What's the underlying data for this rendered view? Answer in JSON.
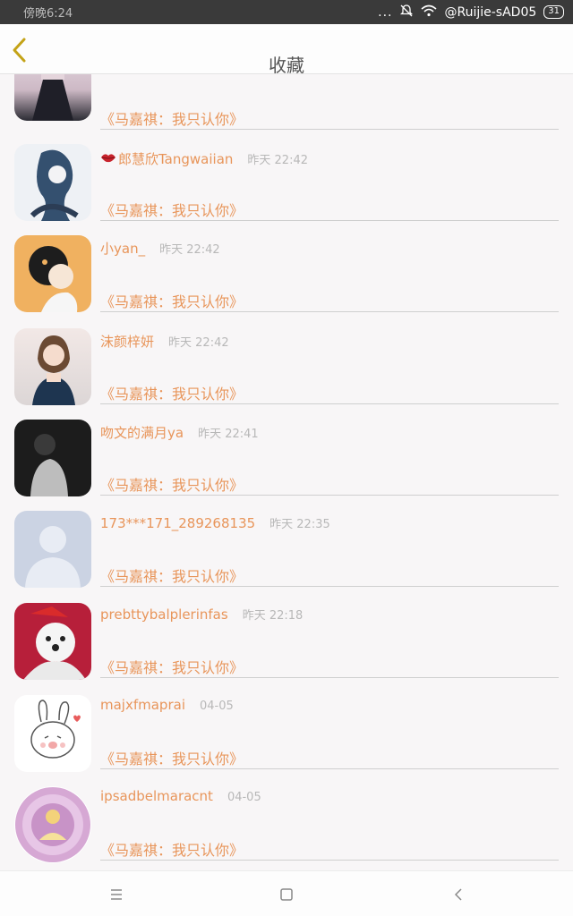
{
  "status_bar": {
    "time": "傍晚6:24",
    "dots": "...",
    "network": "@Ruijie-sAD05",
    "battery": "31"
  },
  "header": {
    "title": "收藏"
  },
  "list": [
    {
      "name": "",
      "time": "",
      "song": "《马嘉祺：我只认你》",
      "avatar_icon": "girl-photo-avatar",
      "avatar_color": "#d9c9d2"
    },
    {
      "name": "郎慧欣Tangwaiian",
      "time": "昨天 22:42",
      "song": "《马嘉祺：我只认你》",
      "avatar_icon": "anime-girl-avatar",
      "avatar_color": "#dfe6ee",
      "has_lips": true
    },
    {
      "name": "小yan_",
      "time": "昨天 22:42",
      "song": "《马嘉祺：我只认你》",
      "avatar_icon": "cartoon-avatar",
      "avatar_color": "#f1b05a"
    },
    {
      "name": "沫颜梓妍",
      "time": "昨天 22:42",
      "song": "《马嘉祺：我只认你》",
      "avatar_icon": "girl-photo-avatar",
      "avatar_color": "#e8d8d3"
    },
    {
      "name": "吻文的满月ya",
      "time": "昨天 22:41",
      "song": "《马嘉祺：我只认你》",
      "avatar_icon": "dark-photo-avatar",
      "avatar_color": "#2a2a2a"
    },
    {
      "name": "173***171_289268135",
      "time": "昨天 22:35",
      "song": "《马嘉祺：我只认你》",
      "avatar_icon": "default-person-avatar",
      "avatar_color": "#c9d2e2"
    },
    {
      "name": "prebttybalplerinfas",
      "time": "昨天 22:18",
      "song": "《马嘉祺：我只认你》",
      "avatar_icon": "dog-photo-avatar",
      "avatar_color": "#b6203a"
    },
    {
      "name": "majxfmaprai",
      "time": "04-05",
      "song": "《马嘉祺：我只认你》",
      "avatar_icon": "bunny-sticker-avatar",
      "avatar_color": "#ffffff"
    },
    {
      "name": "ipsadbelmaracnt",
      "time": "04-05",
      "song": "《马嘉祺：我只认你》",
      "avatar_icon": "ornate-circle-avatar",
      "avatar_color": "#d8b3d8"
    }
  ],
  "nav": {
    "menu_icon": "menu-icon",
    "home_icon": "home-icon",
    "back_icon": "back-icon"
  },
  "colors": {
    "accent": "#e8955a",
    "back_arrow": "#c4a317",
    "time_text": "#b8b8b8"
  }
}
